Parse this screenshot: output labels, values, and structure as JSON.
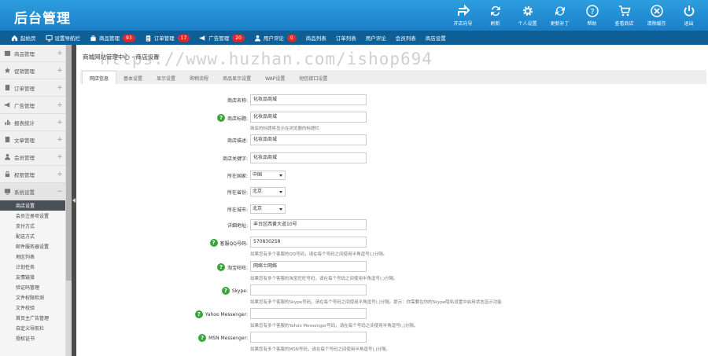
{
  "app": {
    "title": "后台管理"
  },
  "toolbar": [
    {
      "icon": "share-icon",
      "label": "开店向导"
    },
    {
      "icon": "refresh-icon",
      "label": "刷新"
    },
    {
      "icon": "gear-icon",
      "label": "个人设置"
    },
    {
      "icon": "update-icon",
      "label": "更新补丁"
    },
    {
      "icon": "help-icon",
      "label": "帮助"
    },
    {
      "icon": "cart-icon",
      "label": "查看商店"
    },
    {
      "icon": "close-icon",
      "label": "清除缓存"
    },
    {
      "icon": "power-icon",
      "label": "退出"
    }
  ],
  "nav": [
    {
      "icon": "home-icon",
      "label": "起始页"
    },
    {
      "icon": "monitor-icon",
      "label": "设置导航栏"
    },
    {
      "icon": "bag-icon",
      "label": "商品管理",
      "badge": "93"
    },
    {
      "icon": "clipboard-icon",
      "label": "订单管理",
      "badge": "17"
    },
    {
      "icon": "megaphone-icon",
      "label": "广告管理",
      "badge": "20"
    },
    {
      "icon": "user-icon",
      "label": "用户评论",
      "badge": "0"
    },
    {
      "label": "商品列表"
    },
    {
      "label": "订单列表"
    },
    {
      "label": "用户评论"
    },
    {
      "label": "会员列表"
    },
    {
      "label": "商店设置"
    }
  ],
  "sidebar": {
    "categories": [
      {
        "icon": "product-icon",
        "label": "商品管理"
      },
      {
        "icon": "promo-icon",
        "label": "促销管理"
      },
      {
        "icon": "order-icon",
        "label": "订单管理"
      },
      {
        "icon": "ad-icon",
        "label": "广告管理"
      },
      {
        "icon": "report-icon",
        "label": "报表统计"
      },
      {
        "icon": "article-icon",
        "label": "文章管理"
      },
      {
        "icon": "members-icon",
        "label": "会员管理"
      },
      {
        "icon": "permission-icon",
        "label": "权限管理"
      },
      {
        "icon": "system-icon",
        "label": "系统设置"
      }
    ],
    "submenu": [
      "商店设置",
      "会员注册项设置",
      "支付方式",
      "配送方式",
      "邮件服务器设置",
      "地区列表",
      "计划任务",
      "友情链接",
      "验证码管理",
      "文件权限检测",
      "文件校验",
      "首页主广告管理",
      "自定义导航栏",
      "授权证书"
    ]
  },
  "breadcrumb": "商城网站管理中心 - 商店设置",
  "watermark": "https://www.huzhan.com/ishop694",
  "tabs": [
    "网店信息",
    "基本设置",
    "显示设置",
    "购物流程",
    "商品显示设置",
    "WAP设置",
    "短信接口设置"
  ],
  "form": {
    "shop_name": {
      "label": "商店名称:",
      "value": "化妆品商城"
    },
    "shop_title": {
      "label": "商店标题:",
      "value": "化妆品商城",
      "note": "商店的标题将显示在浏览器的标题栏"
    },
    "shop_desc": {
      "label": "商店描述:",
      "value": "化妆品商城"
    },
    "shop_keywords": {
      "label": "商店关键字:",
      "value": "化妆品商城"
    },
    "country": {
      "label": "所在国家:",
      "value": "中国"
    },
    "province": {
      "label": "所在省份:",
      "value": "北京"
    },
    "city": {
      "label": "所在城市:",
      "value": "北京"
    },
    "address": {
      "label": "详细地址:",
      "value": "丰台区西黄大道10号"
    },
    "qq": {
      "label": "客服QQ号码:",
      "value": "570830258",
      "note": "如果您有多个客服的QQ号码，请在每个号码之间使用半角逗号(,)分隔。"
    },
    "wangwang": {
      "label": "淘宝旺旺:",
      "value": "网络士网络",
      "note": "如果您有多个客服的淘宝旺旺号码，请在每个号码之间使用半角逗号(,)分隔。"
    },
    "skype": {
      "label": "Skype:",
      "value": "",
      "note": "如果您有多个客服的Skype号码，请在每个号码之间使用半角逗号(,)分隔。提示：你需要在你的Skype隐私设置中启用状态显示功能"
    },
    "yahoo": {
      "label": "Yahoo Messenger:",
      "value": "",
      "note": "如果您有多个客服的Yahoo Messenger号码，请在每个号码之间使用半角逗号(,)分隔。"
    },
    "msn": {
      "label": "MSN Messenger:",
      "value": "",
      "note": "如果您有多个客服的MSN号码，请在每个号码之间使用半角逗号(,)分隔。"
    }
  },
  "colors": {
    "topbar": "#1e88d0",
    "navbar": "#0f5f97",
    "badge": "#e02a2a",
    "help": "#3aa33a",
    "active_sub": "#4a5057"
  }
}
